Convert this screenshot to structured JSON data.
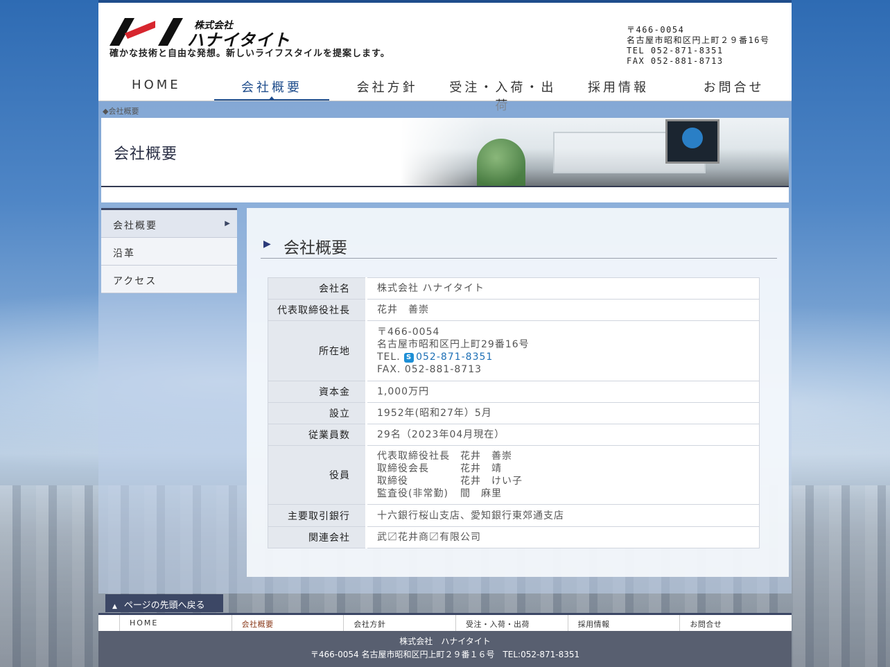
{
  "header": {
    "logo_small": "株式会社",
    "logo_big": "ハナイタイト",
    "tagline": "確かな技術と自由な発想。新しいライフスタイルを提案します。",
    "address_lines": [
      "〒466-0054",
      "名古屋市昭和区円上町２９番16号",
      "TEL 052-871-8351",
      "FAX 052-881-8713"
    ]
  },
  "nav": {
    "items": [
      "HOME",
      "会社概要",
      "会社方針",
      "受注・入荷・出荷",
      "採用情報",
      "お問合せ"
    ],
    "active_index": 1
  },
  "breadcrumb": "◆会社概要",
  "hero": {
    "title": "会社概要"
  },
  "side_nav": {
    "items": [
      "会社概要",
      "沿革",
      "アクセス"
    ],
    "active_index": 0
  },
  "section": {
    "title": "会社概要"
  },
  "company": {
    "rows": [
      {
        "label": "会社名",
        "value": "株式会社 ハナイタイト"
      },
      {
        "label": "代表取締役社長",
        "value": "花井　善崇"
      },
      {
        "label": "所在地",
        "lines": [
          "〒466-0054",
          "名古屋市昭和区円上町29番16号"
        ],
        "tel_prefix": "TEL.",
        "tel": "052-871-8351",
        "fax": "FAX. 052-881-8713"
      },
      {
        "label": "資本金",
        "value": "1,000万円"
      },
      {
        "label": "設立",
        "value": "1952年(昭和27年）5月"
      },
      {
        "label": "従業員数",
        "value": "29名（2023年04月現在）"
      },
      {
        "label": "役員",
        "officers": [
          {
            "role": "代表取締役社長",
            "name": "花井　善崇"
          },
          {
            "role": "取締役会長",
            "name": "花井　靖"
          },
          {
            "role": "取締役",
            "name": "花井　けい子"
          },
          {
            "role": "監査役(非常勤)",
            "name": "間　麻里"
          }
        ]
      },
      {
        "label": "主要取引銀行",
        "value": "十六銀行桜山支店、愛知銀行東郊通支店"
      },
      {
        "label": "関連会社",
        "value": "武〼花井商〼有限公司"
      }
    ]
  },
  "pagetop": {
    "label": "ページの先頭へ戻る"
  },
  "footer": {
    "nav": [
      "HOME",
      "会社概要",
      "会社方針",
      "受注・入荷・出荷",
      "採用情報",
      "お問合せ"
    ],
    "company": "株式会社　ハナイタイト",
    "address": "〒466-0054 名古屋市昭和区円上町２９番１６号　TEL:052-871-8351"
  },
  "colors": {
    "brand_navy": "#1f4d8c",
    "dark_slate": "#3c4765",
    "logo_red": "#d7262e"
  }
}
